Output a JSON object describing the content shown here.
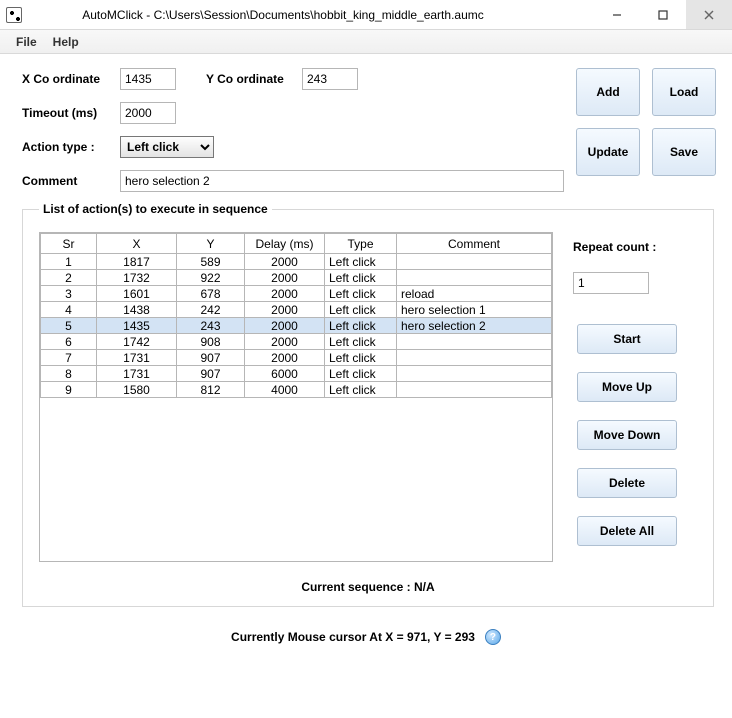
{
  "window": {
    "title": "AutoMClick - C:\\Users\\Session\\Documents\\hobbit_king_middle_earth.aumc"
  },
  "menu": {
    "file": "File",
    "help": "Help"
  },
  "form": {
    "x_label": "X Co ordinate",
    "x_value": "1435",
    "y_label": "Y Co ordinate",
    "y_value": "243",
    "timeout_label": "Timeout (ms)",
    "timeout_value": "2000",
    "action_label": "Action type :",
    "action_value": "Left click",
    "comment_label": "Comment",
    "comment_value": "hero selection 2"
  },
  "buttons": {
    "add": "Add",
    "load": "Load",
    "update": "Update",
    "save": "Save",
    "start": "Start",
    "move_up": "Move Up",
    "move_down": "Move Down",
    "delete": "Delete",
    "delete_all": "Delete All"
  },
  "list": {
    "legend": "List of action(s) to execute in sequence",
    "headers": {
      "sr": "Sr",
      "x": "X",
      "y": "Y",
      "delay": "Delay (ms)",
      "type": "Type",
      "comment": "Comment"
    },
    "selected_index": 4,
    "rows": [
      {
        "sr": "1",
        "x": "1817",
        "y": "589",
        "delay": "2000",
        "type": "Left click",
        "comment": ""
      },
      {
        "sr": "2",
        "x": "1732",
        "y": "922",
        "delay": "2000",
        "type": "Left click",
        "comment": ""
      },
      {
        "sr": "3",
        "x": "1601",
        "y": "678",
        "delay": "2000",
        "type": "Left click",
        "comment": "reload"
      },
      {
        "sr": "4",
        "x": "1438",
        "y": "242",
        "delay": "2000",
        "type": "Left click",
        "comment": "hero selection 1"
      },
      {
        "sr": "5",
        "x": "1435",
        "y": "243",
        "delay": "2000",
        "type": "Left click",
        "comment": "hero selection 2"
      },
      {
        "sr": "6",
        "x": "1742",
        "y": "908",
        "delay": "2000",
        "type": "Left click",
        "comment": ""
      },
      {
        "sr": "7",
        "x": "1731",
        "y": "907",
        "delay": "2000",
        "type": "Left click",
        "comment": ""
      },
      {
        "sr": "8",
        "x": "1731",
        "y": "907",
        "delay": "6000",
        "type": "Left click",
        "comment": ""
      },
      {
        "sr": "9",
        "x": "1580",
        "y": "812",
        "delay": "4000",
        "type": "Left click",
        "comment": ""
      }
    ]
  },
  "repeat": {
    "label": "Repeat count :",
    "value": "1"
  },
  "sequence": "Current sequence : N/A",
  "cursor": "Currently Mouse cursor At X = 971, Y = 293"
}
